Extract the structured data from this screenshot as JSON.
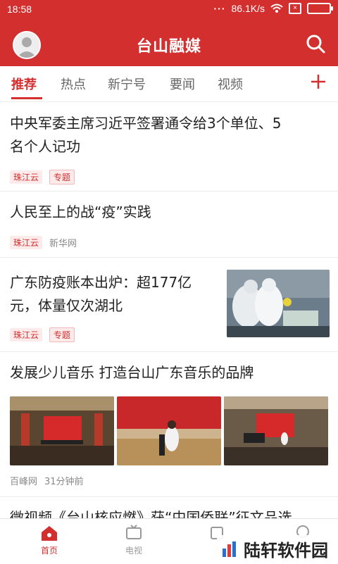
{
  "status": {
    "time": "18:58",
    "speed": "86.1K/s"
  },
  "app": {
    "title": "台山融媒"
  },
  "tabs": [
    {
      "label": "推荐"
    },
    {
      "label": "热点"
    },
    {
      "label": "新宁号"
    },
    {
      "label": "要闻"
    },
    {
      "label": "视频"
    }
  ],
  "articles": [
    {
      "title_line1": "中央军委主席习近平签署通令给3个单位、5",
      "title_line2": "名个人记功",
      "source": "珠江云",
      "tag": "专题"
    },
    {
      "title_line1": "人民至上的战“疫”实践",
      "source": "珠江云",
      "publisher": "新华网"
    },
    {
      "title_line1": "广东防疫账本出炉：超177亿",
      "title_line2": "元，体量仅次湖北",
      "source": "珠江云",
      "tag": "专题"
    },
    {
      "title_line1": "发展少儿音乐 打造台山广东音乐的品牌",
      "publisher": "百峰网",
      "time": "31分钟前"
    },
    {
      "title_line1": "微视频《台山核应燃》获“中国侨联”征文品选"
    }
  ],
  "bottom_nav": [
    {
      "label": "首页"
    },
    {
      "label": "电视"
    },
    {
      "label": ""
    },
    {
      "label": ""
    }
  ],
  "watermark": {
    "text": "陆轩软件园"
  },
  "colors": {
    "brand": "#d32f2f"
  }
}
